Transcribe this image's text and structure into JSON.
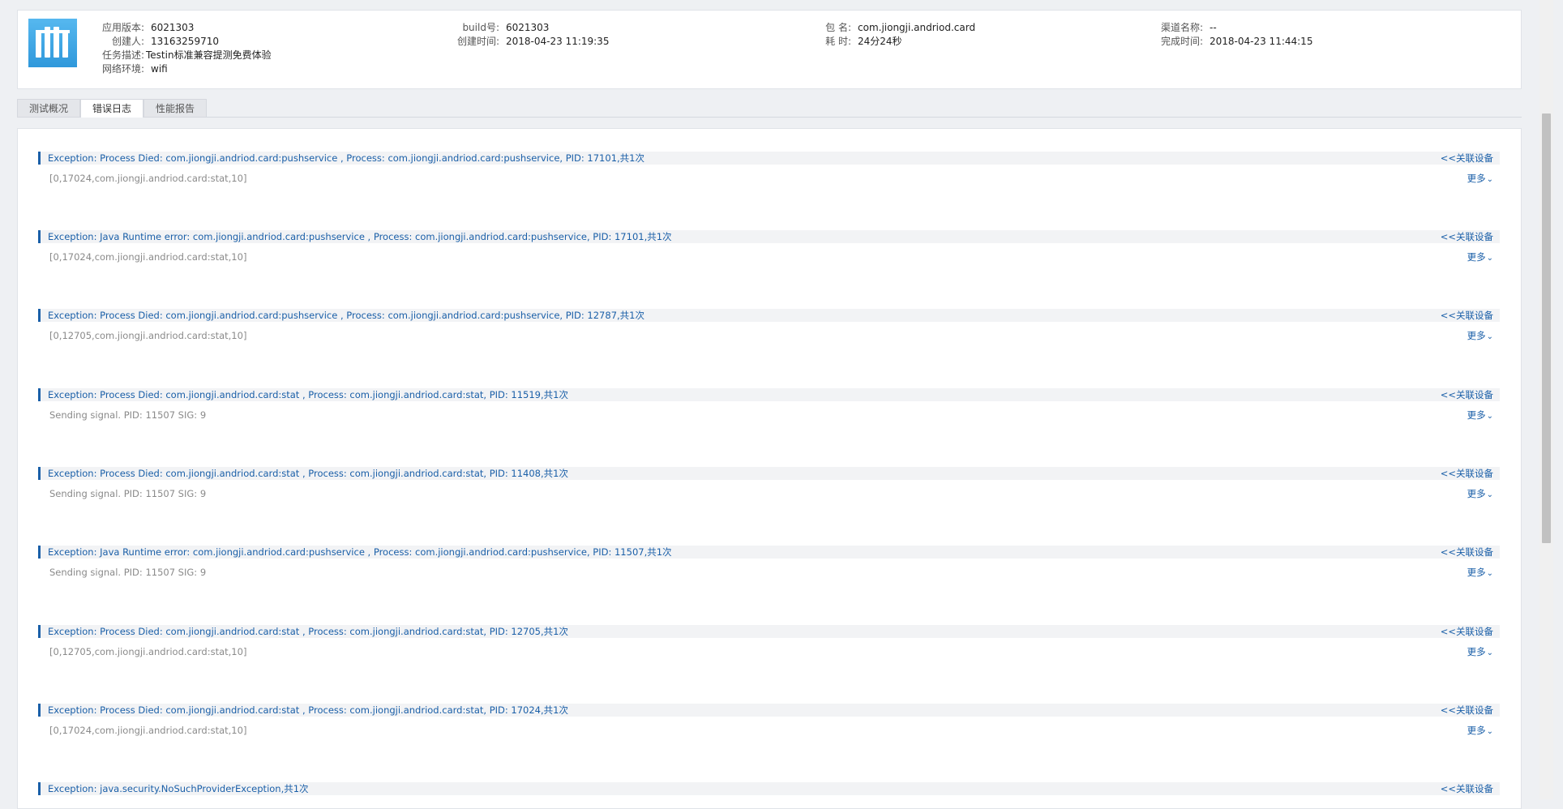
{
  "header": {
    "app_version_label": "应用版本:",
    "app_version_value": "6021303",
    "creator_label": "创建人:",
    "creator_value": "13163259710",
    "task_desc_label": "任务描述:",
    "task_desc_value": "Testin标准兼容提测免费体验",
    "network_label": "网络环境:",
    "network_value": "wifi",
    "build_label": "build号:",
    "build_value": "6021303",
    "created_time_label": "创建时间:",
    "created_time_value": "2018-04-23 11:19:35",
    "package_label": "包 名:",
    "package_value": "com.jiongji.andriod.card",
    "duration_label": "耗 时:",
    "duration_value": "24分24秒",
    "channel_label": "渠道名称:",
    "channel_value": "--",
    "finished_time_label": "完成时间:",
    "finished_time_value": "2018-04-23 11:44:15"
  },
  "tabs": [
    {
      "label": "测试概况",
      "active": false
    },
    {
      "label": "错误日志",
      "active": true
    },
    {
      "label": "性能报告",
      "active": false
    }
  ],
  "log": {
    "related_link": "<<关联设备",
    "more_label": "更多",
    "entries": [
      {
        "exception": "Exception: Process Died: com.jiongji.andriod.card:pushservice , Process: com.jiongji.andriod.card:pushservice, PID: 17101,共1次",
        "detail": "[0,17024,com.jiongji.andriod.card:stat,10]"
      },
      {
        "exception": "Exception: Java Runtime error: com.jiongji.andriod.card:pushservice , Process: com.jiongji.andriod.card:pushservice, PID: 17101,共1次",
        "detail": "[0,17024,com.jiongji.andriod.card:stat,10]"
      },
      {
        "exception": "Exception: Process Died: com.jiongji.andriod.card:pushservice , Process: com.jiongji.andriod.card:pushservice, PID: 12787,共1次",
        "detail": "[0,12705,com.jiongji.andriod.card:stat,10]"
      },
      {
        "exception": "Exception: Process Died: com.jiongji.andriod.card:stat , Process: com.jiongji.andriod.card:stat, PID: 11519,共1次",
        "detail": "Sending signal. PID: 11507 SIG: 9"
      },
      {
        "exception": "Exception: Process Died: com.jiongji.andriod.card:stat , Process: com.jiongji.andriod.card:stat, PID: 11408,共1次",
        "detail": "Sending signal. PID: 11507 SIG: 9"
      },
      {
        "exception": "Exception: Java Runtime error: com.jiongji.andriod.card:pushservice , Process: com.jiongji.andriod.card:pushservice, PID: 11507,共1次",
        "detail": "Sending signal. PID: 11507 SIG: 9"
      },
      {
        "exception": "Exception: Process Died: com.jiongji.andriod.card:stat , Process: com.jiongji.andriod.card:stat, PID: 12705,共1次",
        "detail": "[0,12705,com.jiongji.andriod.card:stat,10]"
      },
      {
        "exception": "Exception: Process Died: com.jiongji.andriod.card:stat , Process: com.jiongji.andriod.card:stat, PID: 17024,共1次",
        "detail": "[0,17024,com.jiongji.andriod.card:stat,10]"
      },
      {
        "exception": "Exception: java.security.NoSuchProviderException,共1次",
        "detail": ""
      }
    ]
  },
  "colors": {
    "link_blue": "#1a5fa8",
    "icon_blue": "#3a9fe0",
    "detail_gray": "#8a8a8a"
  },
  "icons": {
    "app_icon": "app-icon",
    "more": "chevron-down-icon"
  }
}
